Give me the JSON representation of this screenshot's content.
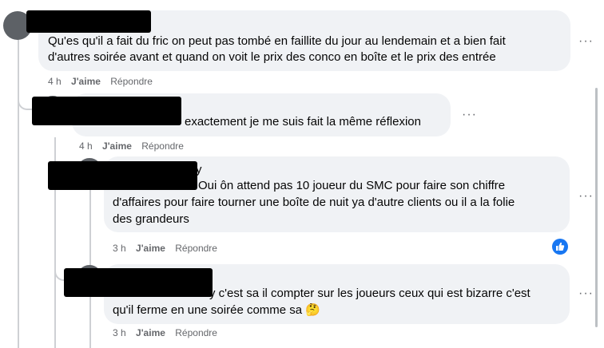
{
  "comments": [
    {
      "text_lines": [
        "Qu'es qu'il a fait du fric on peut pas tombé en faillite du jour au lendemain et a bien fait",
        "d'autres soirée avant et quand on voit le prix des conco en boîte et le prix des entrée"
      ],
      "time": "4 h",
      "like_label": "J'aime",
      "reply_label": "Répondre"
    },
    {
      "text_lines": [
        "exactement je me suis fait la même réflexion"
      ],
      "time": "4 h",
      "like_label": "J'aime",
      "reply_label": "Répondre"
    },
    {
      "name_fragment": "y",
      "text_lines": [
        "Oui ôn attend pas 10 joueur du SMC pour faire son chiffre",
        "d'affaires pour faire tourner une boîte de nuit ya d'autre clients ou il a la folie",
        "des grandeurs"
      ],
      "time": "3 h",
      "like_label": "J'aime",
      "reply_label": "Répondre",
      "reaction": "like"
    },
    {
      "text_lines": [
        "y c'est sa il compter sur les joueurs ceux qui est bizarre c'est",
        "qu'il ferme en une soirée comme sa 🤔"
      ],
      "time": "3 h",
      "like_label": "J'aime",
      "reply_label": "Répondre"
    }
  ],
  "more_label": "···",
  "colors": {
    "bubble": "#f0f2f5",
    "meta": "#65676b",
    "like_blue": "#1877f2"
  },
  "icons": {
    "reaction": "thumbs-up-icon",
    "more": "more-options-icon"
  }
}
